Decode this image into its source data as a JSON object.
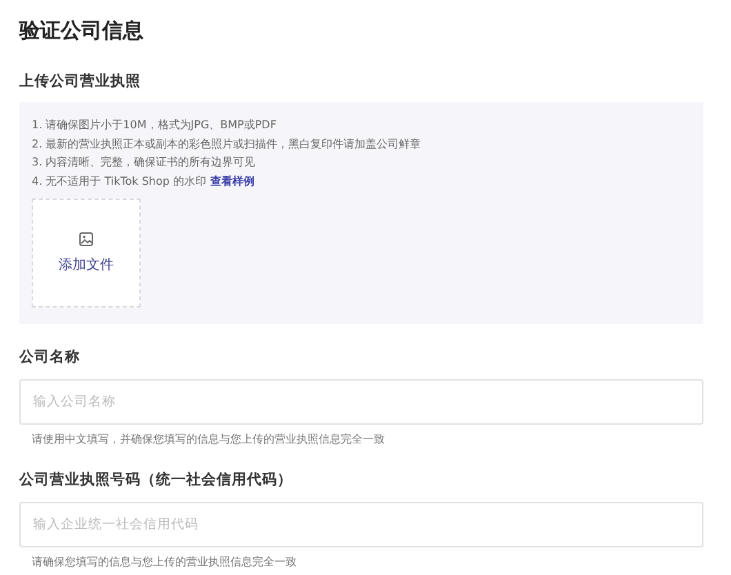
{
  "title": "验证公司信息",
  "upload_section": {
    "label": "上传公司营业执照",
    "requirements": [
      "1. 请确保图片小于10M，格式为JPG、BMP或PDF",
      "2. 最新的营业执照正本或副本的彩色照片或扫描件，黑白复印件请加盖公司鲜章",
      "3. 内容清晰、完整，确保证书的所有边界可见",
      "4. 无不适用于 TikTok Shop 的水印"
    ],
    "sample_link": "查看样例",
    "add_file_button": "添加文件"
  },
  "fields": [
    {
      "label": "公司名称",
      "placeholder": "输入公司名称",
      "help": "请使用中文填写，并确保您填写的信息与您上传的营业执照信息完全一致"
    },
    {
      "label": "公司营业执照号码（统一社会信用代码）",
      "placeholder": "输入企业统一社会信用代码",
      "help": "请确保您填写的信息与您上传的营业执照信息完全一致"
    }
  ]
}
